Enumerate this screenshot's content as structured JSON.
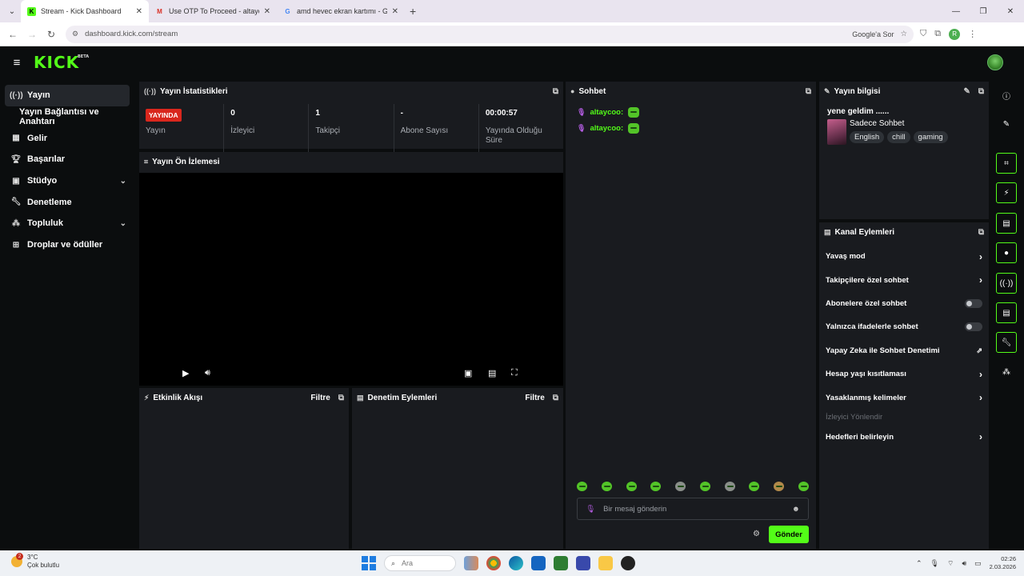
{
  "browser": {
    "tabs": [
      {
        "title": "Stream - Kick Dashboard",
        "fav": "K",
        "fav_color": "#53fc18",
        "active": true
      },
      {
        "title": "Use OTP To Proceed - altaycoo",
        "fav": "M",
        "fav_color": "#ffffff",
        "active": false
      },
      {
        "title": "amd hevec ekran kartımı - Goo",
        "fav": "G",
        "fav_color": "#ffffff",
        "active": false
      }
    ],
    "url": "dashboard.kick.com/stream",
    "google_search_chip": "Google'a Sor",
    "profile_initial": "R"
  },
  "header": {
    "logo": "KICK",
    "logo_tag": "BETA"
  },
  "sidebar": {
    "items": [
      {
        "label": "Yayın",
        "icon": "broadcast-icon"
      },
      {
        "label": "Yayın Bağlantısı ve Anahtarı"
      },
      {
        "label": "Gelir",
        "icon": "revenue-icon"
      },
      {
        "label": "Başarılar",
        "icon": "trophy-icon"
      },
      {
        "label": "Stüdyo",
        "icon": "studio-icon"
      },
      {
        "label": "Denetleme",
        "icon": "wrench-icon"
      },
      {
        "label": "Topluluk",
        "icon": "community-icon"
      },
      {
        "label": "Droplar ve ödüller",
        "icon": "gift-icon"
      }
    ]
  },
  "stats_panel": {
    "title": "Yayın İstatistikleri",
    "live_badge": "YAYINDA",
    "stats": [
      {
        "value": "",
        "label": "Yayın"
      },
      {
        "value": "0",
        "label": "İzleyici"
      },
      {
        "value": "1",
        "label": "Takipçi"
      },
      {
        "value": "-",
        "label": "Abone Sayısı"
      },
      {
        "value": "00:00:57",
        "label": "Yayında Olduğu Süre"
      }
    ]
  },
  "preview_panel": {
    "title": "Yayın Ön İzlemesi"
  },
  "activity_panel": {
    "title": "Etkinlik Akışı",
    "filter": "Filtre"
  },
  "moderation_panel": {
    "title": "Denetim Eylemleri",
    "filter": "Filtre"
  },
  "chat_panel": {
    "title": "Sohbet",
    "messages": [
      {
        "user": "altaycoo:"
      },
      {
        "user": "altaycoo:"
      }
    ],
    "input_placeholder": "Bir mesaj gönderin",
    "send_label": "Gönder"
  },
  "stream_info": {
    "title": "Yayın bilgisi",
    "stream_title": "yene geldim ......",
    "category": "Sadece Sohbet",
    "tags": [
      "English",
      "chill",
      "gaming"
    ]
  },
  "channel_actions": {
    "title": "Kanal Eylemleri",
    "rows": [
      {
        "label": "Yavaş mod",
        "control": "chevron"
      },
      {
        "label": "Takipçilere özel sohbet",
        "control": "chevron"
      },
      {
        "label": "Abonelere özel sohbet",
        "control": "toggle",
        "on": false
      },
      {
        "label": "Yalnızca ifadelerle sohbet",
        "control": "toggle",
        "on": false
      },
      {
        "label": "Yapay Zeka ile Sohbet Denetimi",
        "control": "external"
      },
      {
        "label": "Hesap yaşı kısıtlaması",
        "control": "chevron"
      },
      {
        "label": "Yasaklanmış kelimeler",
        "control": "chevron"
      },
      {
        "label": "İzleyici Yönlendir",
        "control": "none",
        "disabled": true
      },
      {
        "label": "Hedefleri belirleyin",
        "control": "chevron"
      }
    ]
  },
  "taskbar": {
    "weather_temp": "3°C",
    "weather_desc": "Çok bulutlu",
    "notification_count": "2",
    "search_placeholder": "Ara",
    "time": "02:26",
    "date": "2.03.2026"
  },
  "colors": {
    "accent": "#53fc18",
    "live": "#d9271d",
    "panel": "#191b1f"
  }
}
